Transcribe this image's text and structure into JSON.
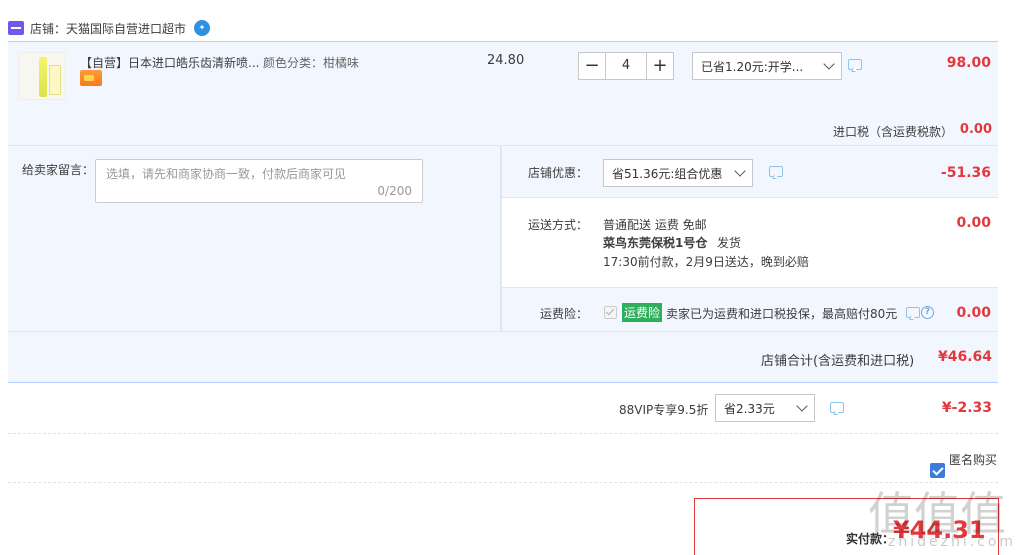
{
  "shop": {
    "label": "店铺：",
    "name": "天猫国际自营进口超市"
  },
  "item": {
    "title": "【自营】日本进口皓乐齿清新喷...",
    "sku_label": "颜色分类：",
    "sku_value": "柑橘味",
    "unit_price": "24.80",
    "quantity": "4",
    "promo_select": "已省1.20元:开学...",
    "subtotal": "98.00"
  },
  "import_tax": {
    "label": "进口税（含运费税款）",
    "value": "0.00"
  },
  "message": {
    "label": "给卖家留言：",
    "placeholder": "选填，请先和商家协商一致，付款后商家可见",
    "counter": "0/200"
  },
  "shop_discount": {
    "label": "店铺优惠：",
    "select": "省51.36元:组合优惠",
    "value": "-51.36"
  },
  "shipping": {
    "label": "运送方式：",
    "line1": "普通配送 运费 免邮",
    "warehouse": "菜鸟东莞保税1号仓",
    "ship_text": "发货",
    "line3": "17:30前付款，2月9日送达，晚到必赔",
    "value": "0.00"
  },
  "insurance": {
    "label": "运费险：",
    "tag": "运费险",
    "text": "卖家已为运费和进口税投保，最高赔付80元",
    "value": "0.00"
  },
  "shop_total": {
    "label": "店铺合计(含运费和进口税)",
    "value": "¥46.64"
  },
  "vip": {
    "label": "88VIP专享9.5折",
    "select": "省2.33元",
    "value": "¥-2.33"
  },
  "anonymous": {
    "label": "匿名购买"
  },
  "pay": {
    "label": "实付款：",
    "value": "¥44.31"
  },
  "watermark": {
    "main": "值值值",
    "sub": "zhidezhi.com"
  },
  "colors": {
    "accent_red": "#e4393c",
    "band_blue": "#f2f7ff",
    "border_blue": "#b2d1ff",
    "check_blue": "#3d7bd9",
    "tag_green": "#2fae5c"
  }
}
